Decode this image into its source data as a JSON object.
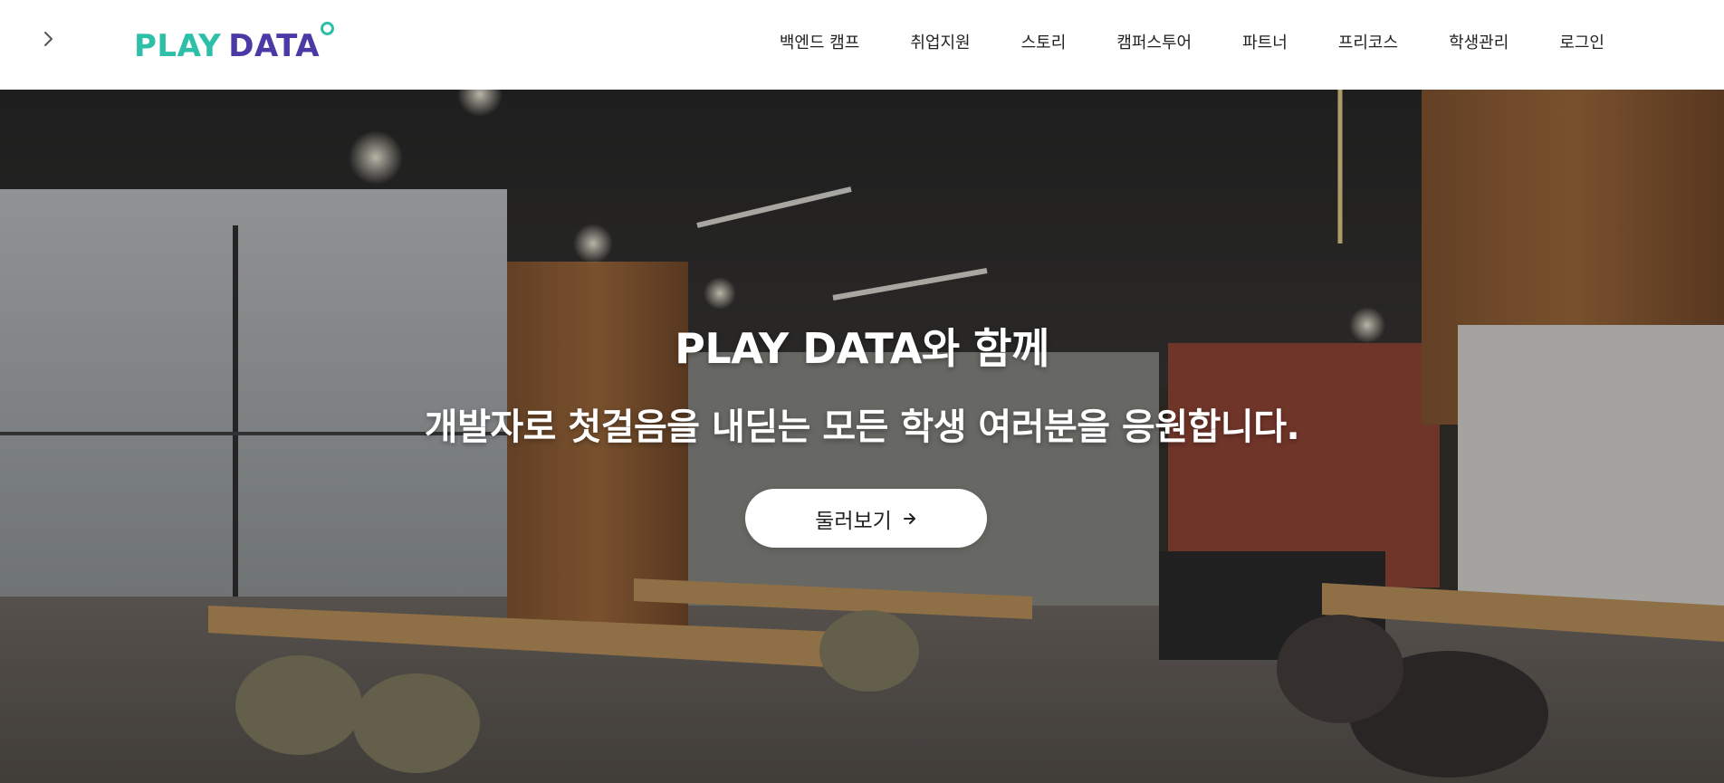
{
  "header": {
    "menu_icon": "chevron-right-icon",
    "logo": {
      "part1": "PLAY",
      "part2": "DATA"
    },
    "nav": [
      {
        "label": "백엔드 캠프"
      },
      {
        "label": "취업지원"
      },
      {
        "label": "스토리"
      },
      {
        "label": "캠퍼스투어"
      },
      {
        "label": "파트너"
      },
      {
        "label": "프리코스"
      },
      {
        "label": "학생관리"
      },
      {
        "label": "로그인"
      }
    ]
  },
  "hero": {
    "title": "PLAY DATA와 함께",
    "subtitle": "개발자로 첫걸음을 내딛는 모든 학생 여러분을 응원합니다.",
    "cta_label": "둘러보기",
    "cta_icon": "arrow-right-icon",
    "background": "cafe-interior-photo"
  },
  "colors": {
    "brand_teal": "#2dbfa8",
    "brand_purple": "#4b3aa6",
    "nav_text": "#222222",
    "hero_text": "#ffffff"
  }
}
